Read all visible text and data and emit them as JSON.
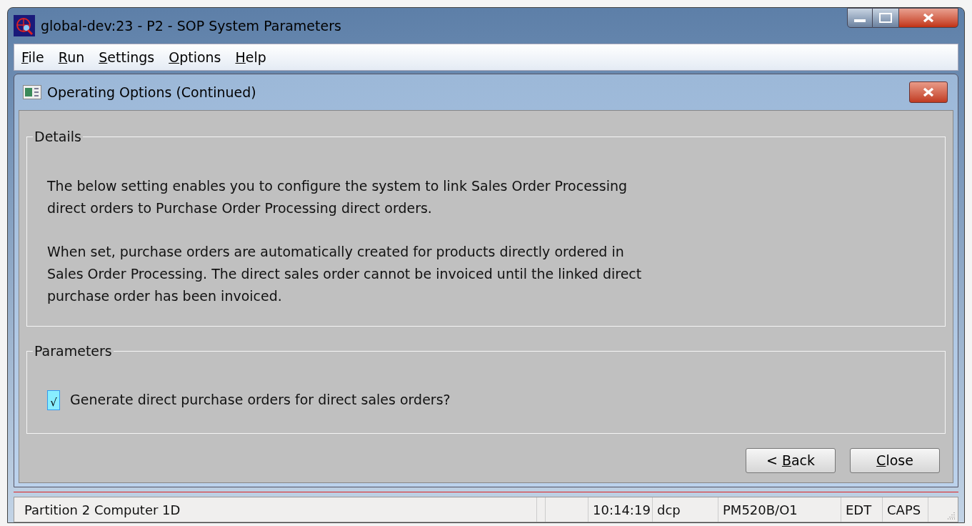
{
  "window": {
    "title": "global-dev:23 - P2 - SOP System Parameters"
  },
  "menu": [
    {
      "key": "F",
      "after": "ile"
    },
    {
      "key": "R",
      "after": "un"
    },
    {
      "key": "S",
      "after": "ettings"
    },
    {
      "key": "O",
      "after": "ptions"
    },
    {
      "key": "H",
      "after": "elp"
    }
  ],
  "dialog": {
    "title": "Operating Options (Continued)",
    "details": {
      "legend": "Details",
      "paragraphs": [
        "The below setting enables you to configure the system to link Sales Order Processing direct orders to Purchase Order Processing direct orders.",
        "When set, purchase orders are automatically created for products directly ordered in Sales Order Processing. The direct sales order cannot be invoiced until the linked direct purchase order has been invoiced."
      ]
    },
    "parameters": {
      "legend": "Parameters",
      "options": [
        {
          "label": "Generate direct purchase orders for direct sales orders?",
          "checked": true,
          "mark": "√"
        }
      ]
    },
    "buttons": [
      {
        "before": "< ",
        "key": "B",
        "after": "ack"
      },
      {
        "key": "C",
        "after": "lose"
      }
    ]
  },
  "status_bar": [
    "Partition 2 Computer 1D",
    "10:14:19",
    "dcp",
    "PM520B/O1",
    "EDT",
    "CAPS"
  ]
}
